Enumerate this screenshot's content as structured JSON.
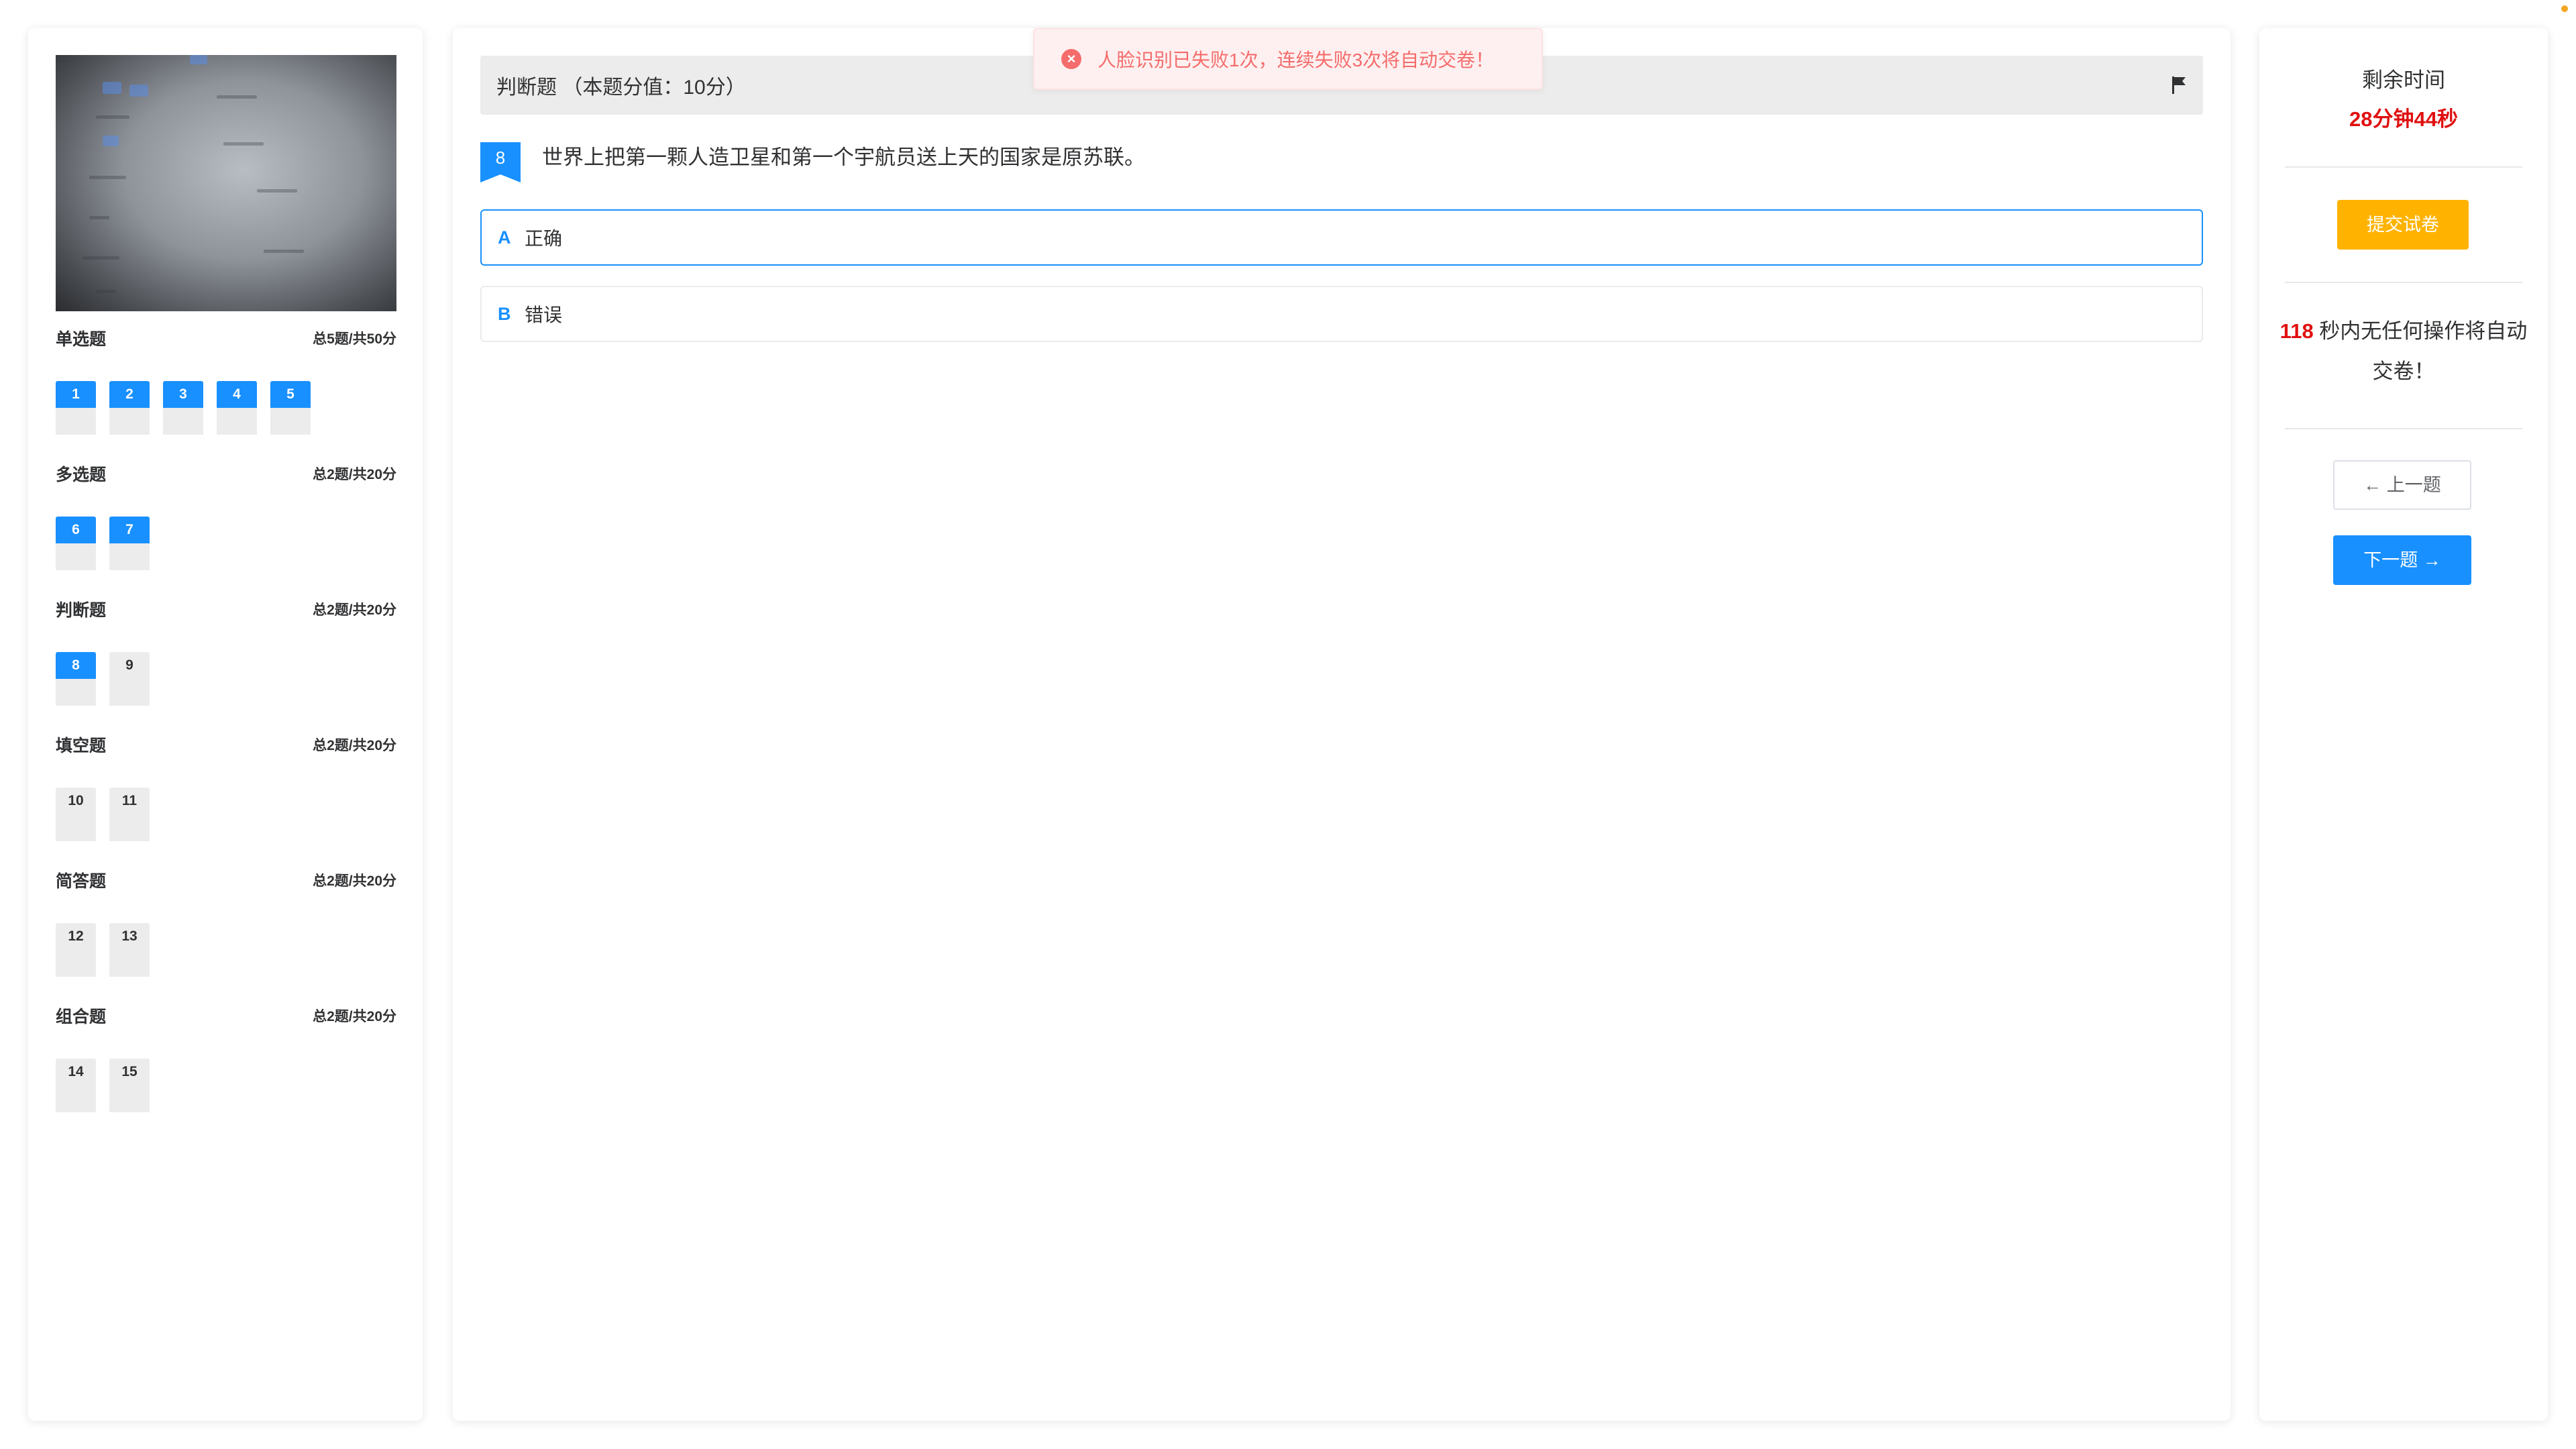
{
  "sidebar": {
    "sections": [
      {
        "title": "单选题",
        "summary": "总5题/共50分",
        "questions": [
          {
            "num": "1",
            "answered": true
          },
          {
            "num": "2",
            "answered": true
          },
          {
            "num": "3",
            "answered": true
          },
          {
            "num": "4",
            "answered": true
          },
          {
            "num": "5",
            "answered": true
          }
        ]
      },
      {
        "title": "多选题",
        "summary": "总2题/共20分",
        "questions": [
          {
            "num": "6",
            "answered": true
          },
          {
            "num": "7",
            "answered": true
          }
        ]
      },
      {
        "title": "判断题",
        "summary": "总2题/共20分",
        "questions": [
          {
            "num": "8",
            "answered": true
          },
          {
            "num": "9",
            "answered": false
          }
        ]
      },
      {
        "title": "填空题",
        "summary": "总2题/共20分",
        "questions": [
          {
            "num": "10",
            "answered": false
          },
          {
            "num": "11",
            "answered": false
          }
        ]
      },
      {
        "title": "简答题",
        "summary": "总2题/共20分",
        "questions": [
          {
            "num": "12",
            "answered": false
          },
          {
            "num": "13",
            "answered": false
          }
        ]
      },
      {
        "title": "组合题",
        "summary": "总2题/共20分",
        "questions": [
          {
            "num": "14",
            "answered": false
          },
          {
            "num": "15",
            "answered": false
          }
        ]
      }
    ]
  },
  "question": {
    "header": "判断题 （本题分值：10分）",
    "number": "8",
    "text": "世界上把第一颗人造卫星和第一个宇航员送上天的国家是原苏联。",
    "flag_icon": "flag-icon",
    "options": [
      {
        "letter": "A",
        "text": "正确",
        "selected": true
      },
      {
        "letter": "B",
        "text": "错误",
        "selected": false
      }
    ]
  },
  "right_panel": {
    "timer_label": "剩余时间",
    "timer_value": "28分钟44秒",
    "submit_label": "提交试卷",
    "idle_seconds": "118",
    "idle_text": " 秒内无任何操作将自动交卷！",
    "prev_label": "← 上一题",
    "next_label": "下一题 →"
  },
  "alert": {
    "icon": "error-icon",
    "text": "人脸识别已失败1次，连续失败3次将自动交卷！"
  },
  "colors": {
    "primary": "#1890ff",
    "warning": "#ffb300",
    "danger": "#e01010",
    "alert_text": "#f56c6c"
  }
}
